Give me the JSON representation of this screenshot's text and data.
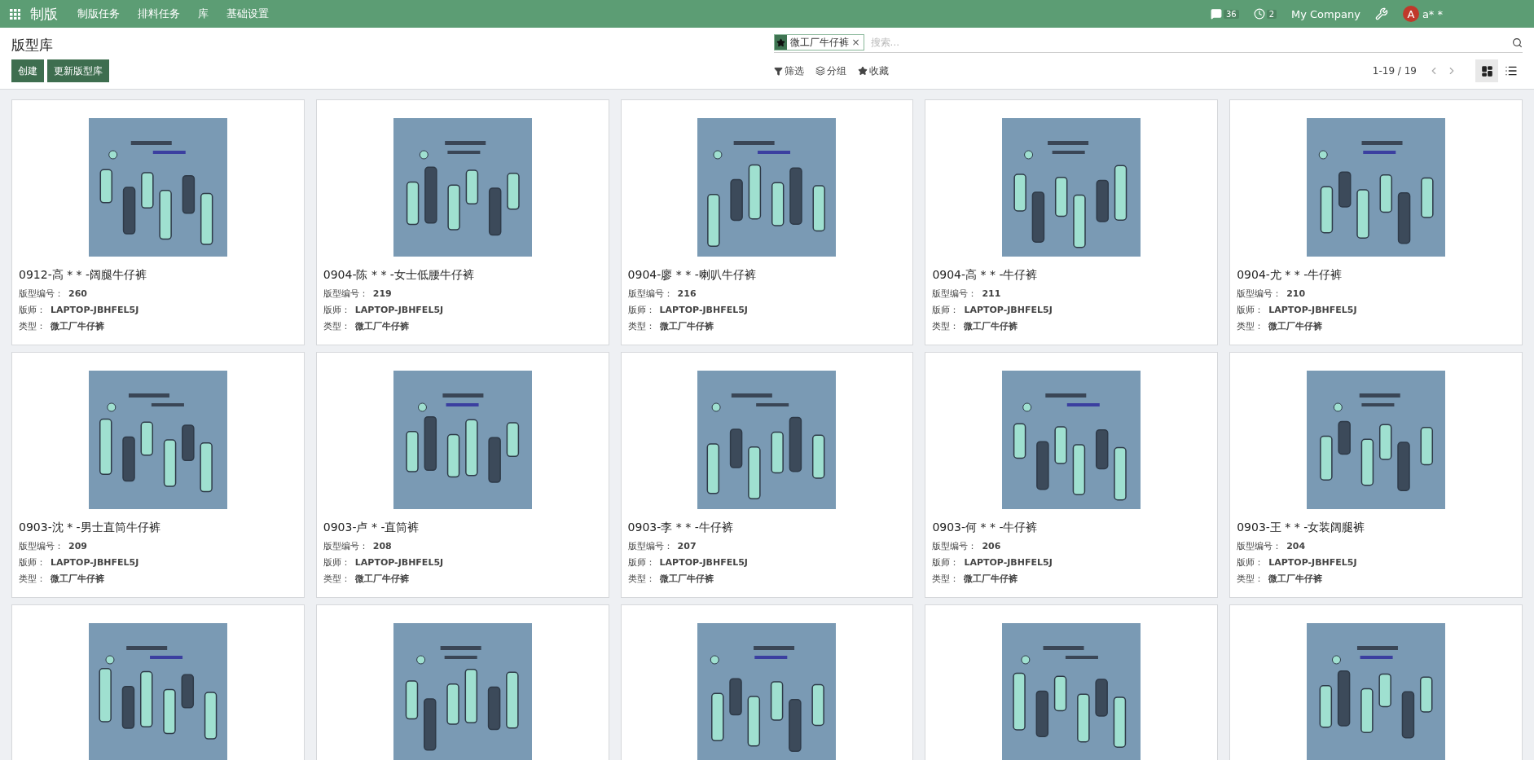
{
  "navbar": {
    "app": "制版",
    "menu": [
      "制版任务",
      "排料任务",
      "库",
      "基础设置"
    ],
    "messages_count": "36",
    "activities_count": "2",
    "company": "My Company",
    "user_initial": "A",
    "user_name": "a* *"
  },
  "control": {
    "title": "版型库",
    "buttons": [
      "创建",
      "更新版型库"
    ],
    "search": {
      "facet": "微工厂牛仔裤",
      "facet_remove": "×",
      "placeholder": "搜索..."
    },
    "filters": [
      {
        "kind": "filter",
        "label": "筛选"
      },
      {
        "kind": "group",
        "label": "分组"
      },
      {
        "kind": "favorite",
        "label": "收藏"
      }
    ],
    "pager": "1-19 / 19",
    "views": [
      {
        "kind": "kanban",
        "selected": true
      },
      {
        "kind": "list",
        "selected": false
      }
    ]
  },
  "cards": [
    {
      "kind": "record",
      "title": "0912-高 * * -阔腿牛仔裤",
      "fields": [
        {
          "label": "版型编号：",
          "value": "260"
        },
        {
          "label": "版师：",
          "value": "LAPTOP-JBHFEL5J"
        },
        {
          "label": "类型：",
          "value": "微工厂牛仔裤"
        }
      ]
    },
    {
      "kind": "record",
      "title": "0904-陈 * * -女士低腰牛仔裤",
      "fields": [
        {
          "label": "版型编号：",
          "value": "219"
        },
        {
          "label": "版师：",
          "value": "LAPTOP-JBHFEL5J"
        },
        {
          "label": "类型：",
          "value": "微工厂牛仔裤"
        }
      ]
    },
    {
      "kind": "record",
      "title": "0904-廖 * * -喇叭牛仔裤",
      "fields": [
        {
          "label": "版型编号：",
          "value": "216"
        },
        {
          "label": "版师：",
          "value": "LAPTOP-JBHFEL5J"
        },
        {
          "label": "类型：",
          "value": "微工厂牛仔裤"
        }
      ]
    },
    {
      "kind": "record",
      "title": "0904-高 * * -牛仔裤",
      "fields": [
        {
          "label": "版型编号：",
          "value": "211"
        },
        {
          "label": "版师：",
          "value": "LAPTOP-JBHFEL5J"
        },
        {
          "label": "类型：",
          "value": "微工厂牛仔裤"
        }
      ]
    },
    {
      "kind": "record",
      "title": "0904-尤 * * -牛仔裤",
      "fields": [
        {
          "label": "版型编号：",
          "value": "210"
        },
        {
          "label": "版师：",
          "value": "LAPTOP-JBHFEL5J"
        },
        {
          "label": "类型：",
          "value": "微工厂牛仔裤"
        }
      ]
    },
    {
      "kind": "record",
      "title": "0903-沈 * -男士直筒牛仔裤",
      "fields": [
        {
          "label": "版型编号：",
          "value": "209"
        },
        {
          "label": "版师：",
          "value": "LAPTOP-JBHFEL5J"
        },
        {
          "label": "类型：",
          "value": "微工厂牛仔裤"
        }
      ]
    },
    {
      "kind": "record",
      "title": "0903-卢 * -直筒裤",
      "fields": [
        {
          "label": "版型编号：",
          "value": "208"
        },
        {
          "label": "版师：",
          "value": "LAPTOP-JBHFEL5J"
        },
        {
          "label": "类型：",
          "value": "微工厂牛仔裤"
        }
      ]
    },
    {
      "kind": "record",
      "title": "0903-李 * * -牛仔裤",
      "fields": [
        {
          "label": "版型编号：",
          "value": "207"
        },
        {
          "label": "版师：",
          "value": "LAPTOP-JBHFEL5J"
        },
        {
          "label": "类型：",
          "value": "微工厂牛仔裤"
        }
      ]
    },
    {
      "kind": "record",
      "title": "0903-何 * * -牛仔裤",
      "fields": [
        {
          "label": "版型编号：",
          "value": "206"
        },
        {
          "label": "版师：",
          "value": "LAPTOP-JBHFEL5J"
        },
        {
          "label": "类型：",
          "value": "微工厂牛仔裤"
        }
      ]
    },
    {
      "kind": "record",
      "title": "0903-王 * * -女装阔腿裤",
      "fields": [
        {
          "label": "版型编号：",
          "value": "204"
        },
        {
          "label": "版师：",
          "value": "LAPTOP-JBHFEL5J"
        },
        {
          "label": "类型：",
          "value": "微工厂牛仔裤"
        }
      ]
    },
    {
      "kind": "picture"
    },
    {
      "kind": "picture"
    },
    {
      "kind": "picture"
    },
    {
      "kind": "picture"
    },
    {
      "kind": "picture"
    }
  ]
}
